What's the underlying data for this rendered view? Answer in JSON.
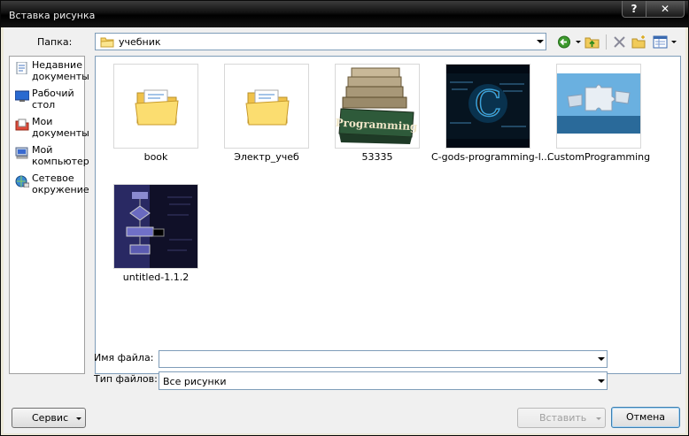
{
  "window": {
    "title": "Вставка рисунка",
    "help_glyph": "?",
    "close_glyph": "✕"
  },
  "toolbar": {
    "folder_label": "Папка:",
    "folder_value": "учебник"
  },
  "places": [
    {
      "label": "Недавние документы",
      "icon": "recent-documents-icon"
    },
    {
      "label": "Рабочий стол",
      "icon": "desktop-icon"
    },
    {
      "label": "Мои документы",
      "icon": "my-documents-icon"
    },
    {
      "label": "Мой компьютер",
      "icon": "my-computer-icon"
    },
    {
      "label": "Сетевое окружение",
      "icon": "network-icon"
    }
  ],
  "files": [
    {
      "name": "book",
      "kind": "folder"
    },
    {
      "name": "Электр_учеб",
      "kind": "folder"
    },
    {
      "name": "53335",
      "kind": "image",
      "text": "Programming"
    },
    {
      "name": "C-gods-programming-l...",
      "kind": "image",
      "text": "C"
    },
    {
      "name": "CustomProgramming",
      "kind": "image"
    },
    {
      "name": "untitled-1.1.2",
      "kind": "image"
    }
  ],
  "footer": {
    "filename_label": "Имя файла:",
    "filename_value": "",
    "filetype_label": "Тип файлов:",
    "filetype_value": "Все рисунки",
    "service_label": "Сервис",
    "insert_label": "Вставить",
    "cancel_label": "Отмена"
  }
}
